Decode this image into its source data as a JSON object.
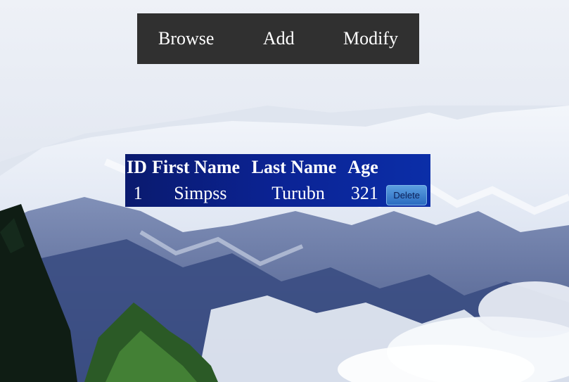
{
  "nav": {
    "items": [
      {
        "label": "Browse"
      },
      {
        "label": "Add"
      },
      {
        "label": "Modify"
      }
    ]
  },
  "table": {
    "headers": [
      "ID",
      "First Name",
      "Last Name",
      "Age"
    ],
    "rows": [
      {
        "id": "1",
        "first_name": "Simpss",
        "last_name": "Turubn",
        "age": "321",
        "action_label": "Delete"
      }
    ]
  },
  "colors": {
    "navbar_bg": "#303030",
    "table_bg": "#0b2394",
    "button_bg": "#3a7fd0"
  }
}
